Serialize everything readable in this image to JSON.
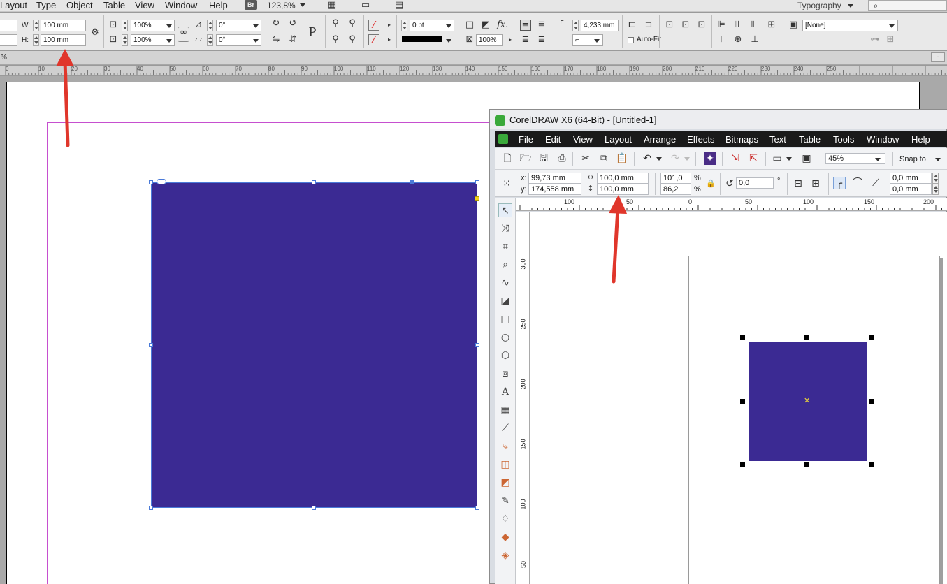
{
  "indesign": {
    "menu": [
      "Layout",
      "Type",
      "Object",
      "Table",
      "View",
      "Window",
      "Help"
    ],
    "bridge_badge": "Br",
    "zoom": "123,8%",
    "workspace": "Typography",
    "control": {
      "w_label": "W:",
      "h_label": "H:",
      "width": "100 mm",
      "height": "100 mm",
      "scale_x": "100%",
      "scale_y": "100%",
      "rotate": "0°",
      "shear": "0°",
      "stroke_weight": "0 pt",
      "opacity": "100%",
      "offset": "4,233 mm",
      "autofit_label": "Auto-Fit",
      "object_style": "[None]"
    },
    "tab_label": "%",
    "ruler_labels": [
      "0",
      "10",
      "20",
      "30",
      "40",
      "50",
      "60",
      "70",
      "80",
      "90",
      "100",
      "110",
      "120",
      "130",
      "140",
      "150",
      "160",
      "170",
      "180",
      "190",
      "200",
      "210",
      "220",
      "230",
      "240",
      "250"
    ],
    "rect_color": "#3b2a93"
  },
  "coreldraw": {
    "title": "CorelDRAW X6 (64-Bit) - [Untitled-1]",
    "menu": [
      "File",
      "Edit",
      "View",
      "Layout",
      "Arrange",
      "Effects",
      "Bitmaps",
      "Text",
      "Table",
      "Tools",
      "Window",
      "Help"
    ],
    "zoom": "45%",
    "snap_to": "Snap to",
    "x_label": "x:",
    "y_label": "y:",
    "x_value": "99,73 mm",
    "y_value": "174,558 mm",
    "width": "100,0 mm",
    "height": "100,0 mm",
    "scale_w": "101,0",
    "scale_h": "86,2",
    "percent": "%",
    "angle": "0,0",
    "degree": "°",
    "outline_1": "0,0 mm",
    "outline_2": "0,0 mm",
    "hruler_labels": [
      "100",
      "50",
      "0",
      "50",
      "100",
      "150",
      "200"
    ],
    "vruler_labels": [
      "300",
      "250",
      "200",
      "150",
      "100",
      "50"
    ],
    "rect_color": "#3b2a93"
  },
  "annotation_color": "#e0362b"
}
